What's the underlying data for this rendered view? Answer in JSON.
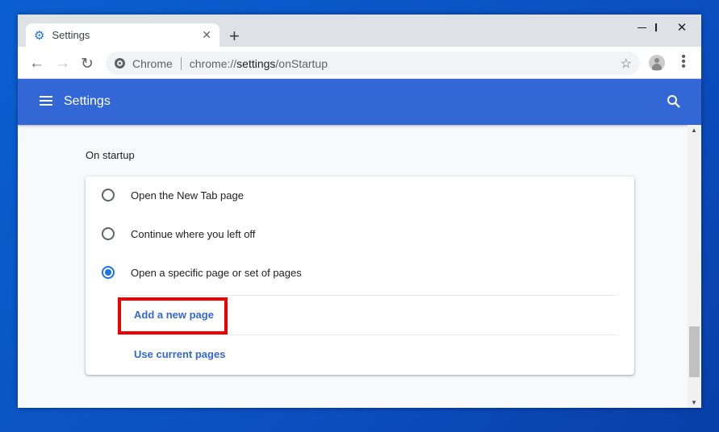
{
  "tab": {
    "title": "Settings"
  },
  "omnibox": {
    "origin_label": "Chrome",
    "url_prefix": "chrome://",
    "url_host": "settings",
    "url_path": "/onStartup"
  },
  "header": {
    "title": "Settings"
  },
  "section": {
    "title": "On startup"
  },
  "options": [
    {
      "label": "Open the New Tab page",
      "selected": false
    },
    {
      "label": "Continue where you left off",
      "selected": false
    },
    {
      "label": "Open a specific page or set of pages",
      "selected": true
    }
  ],
  "links": {
    "add_page": "Add a new page",
    "use_current": "Use current pages"
  },
  "colors": {
    "header": "#3367d6",
    "highlight": "#ee0000",
    "link": "#3367d6"
  }
}
